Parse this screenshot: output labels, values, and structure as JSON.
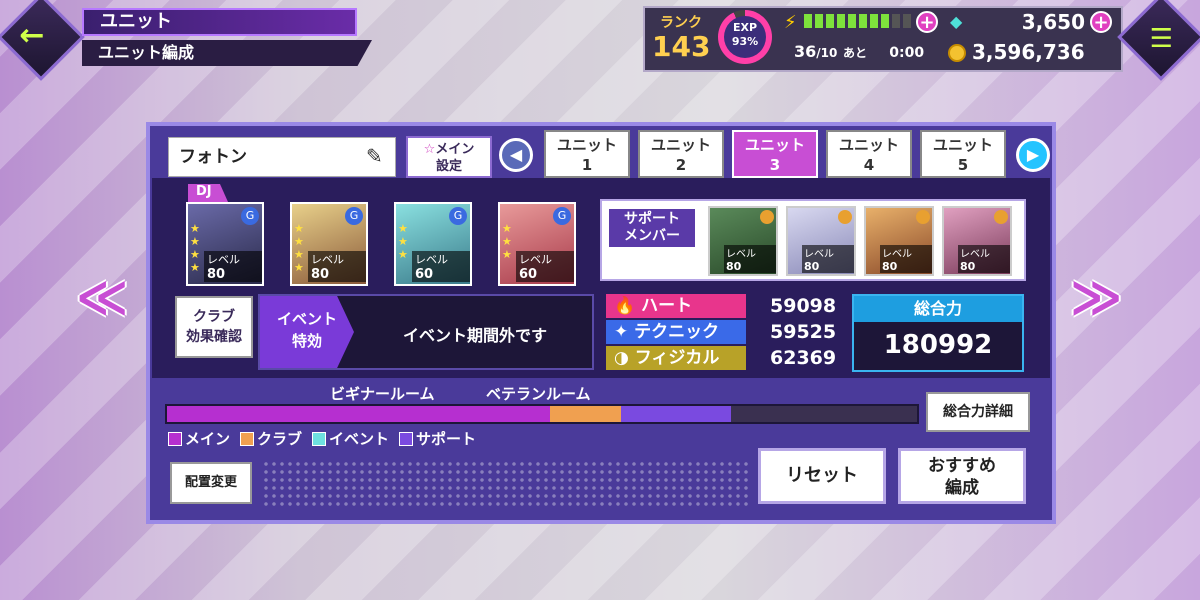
{
  "header": {
    "title": "ユニット",
    "subtitle": "ユニット編成"
  },
  "status": {
    "rank_label": "ランク",
    "rank_value": "143",
    "exp_label": "EXP",
    "exp_percent": "93%",
    "stamina": "36",
    "stamina_max": "/10",
    "stamina_suffix": "あと",
    "timer": "0:00",
    "gems": "3,650",
    "coins": "3,596,736",
    "plus": "+"
  },
  "unit": {
    "name": "フォトン",
    "main_set_line1": "メイン",
    "main_set_line2": "設定",
    "tabs": [
      {
        "line1": "ユニット",
        "line2": "1"
      },
      {
        "line1": "ユニット",
        "line2": "2"
      },
      {
        "line1": "ユニット",
        "line2": "3"
      },
      {
        "line1": "ユニット",
        "line2": "4"
      },
      {
        "line1": "ユニット",
        "line2": "5"
      }
    ],
    "active_tab": 3,
    "dj_tag": "DJ",
    "level_label": "レベル",
    "main_cards": [
      {
        "level": "80"
      },
      {
        "level": "80"
      },
      {
        "level": "60"
      },
      {
        "level": "60"
      }
    ],
    "support_label_line1": "サポート",
    "support_label_line2": "メンバー",
    "support_cards": [
      {
        "level": "80"
      },
      {
        "level": "80"
      },
      {
        "level": "80"
      },
      {
        "level": "80"
      }
    ]
  },
  "club_button": {
    "line1": "クラブ",
    "line2": "効果確認"
  },
  "event": {
    "label_line1": "イベント",
    "label_line2": "特効",
    "text": "イベント期間外です"
  },
  "stats": [
    {
      "name": "ハート",
      "value": "59098",
      "color": "#e8358c",
      "icon": "flame-icon",
      "glyph": "🔥"
    },
    {
      "name": "テクニック",
      "value": "59525",
      "color": "#3a6ae8",
      "icon": "sparkle-icon",
      "glyph": "✦"
    },
    {
      "name": "フィジカル",
      "value": "62369",
      "color": "#b8a228",
      "icon": "crescent-icon",
      "glyph": "◑"
    }
  ],
  "total": {
    "label": "総合力",
    "value": "180992"
  },
  "rooms": {
    "beginner": "ビギナールーム",
    "veteran": "ベテランルーム"
  },
  "power_breakdown": [
    {
      "category": "メイン",
      "fraction": 0.51,
      "color": "#b62fd0"
    },
    {
      "category": "クラブ",
      "fraction": 0.095,
      "color": "#f0a050"
    },
    {
      "category": "イベント",
      "fraction": 0.0,
      "color": "#6ee0e0"
    },
    {
      "category": "サポート",
      "fraction": 0.147,
      "color": "#7a4ae0"
    }
  ],
  "detail_button": "総合力詳細",
  "layout_button": "配置変更",
  "reset_button": "リセット",
  "recommend_button": {
    "line1": "おすすめ",
    "line2": "編成"
  },
  "icons": {
    "back": "←",
    "menu": "☰",
    "left": "◀",
    "right": "▶",
    "side_left": "≪",
    "side_right": "≫",
    "pencil": "✎",
    "star": "☆",
    "bolt": "⚡",
    "gem": "◆"
  }
}
